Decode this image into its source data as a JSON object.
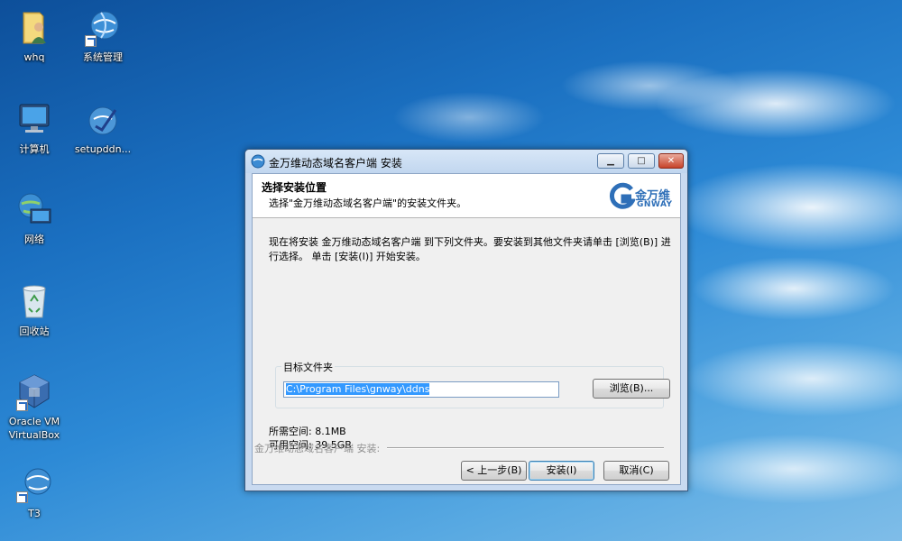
{
  "desktop": {
    "icons": [
      {
        "label": "whq"
      },
      {
        "label": "系统管理"
      },
      {
        "label": "计算机"
      },
      {
        "label": "setupddn..."
      },
      {
        "label": "网络"
      },
      {
        "label": "回收站"
      },
      {
        "label": "Oracle VM VirtualBox"
      },
      {
        "label": "T3"
      }
    ]
  },
  "window": {
    "title": "金万维动态域名客户端 安装",
    "controls": {
      "minimize": "▁",
      "maximize": "□",
      "close": "✕"
    },
    "header": {
      "title": "选择安装位置",
      "subtitle": "选择\"金万维动态域名客户端\"的安装文件夹。",
      "logo_cn": "金万维",
      "logo_en": "GNWAY"
    },
    "description": "现在将安装 金万维动态域名客户端 到下列文件夹。要安装到其他文件夹请单击 [浏览(B)] 进行选择。 单击 [安装(I)] 开始安装。",
    "target": {
      "label": "目标文件夹",
      "path": "C:\\Program Files\\gnway\\ddns",
      "browse": "浏览(B)..."
    },
    "space_required": "所需空间: 8.1MB",
    "space_available": "可用空间: 39.5GB",
    "status": "金万维动态域名客户端 安装:",
    "buttons": {
      "back": "< 上一步(B)",
      "install": "安装(I)",
      "cancel": "取消(C)"
    }
  }
}
